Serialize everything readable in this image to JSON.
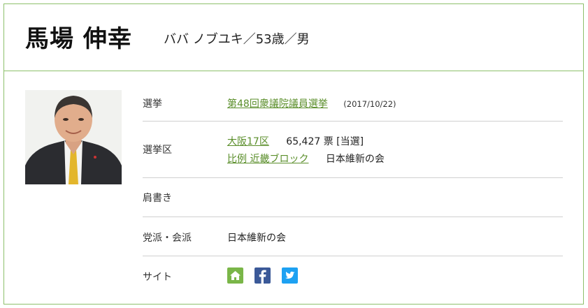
{
  "candidate": {
    "name": "馬場 伸幸",
    "kana_info": "ババ ノブユキ／53歳／男"
  },
  "rows": {
    "election": {
      "label": "選挙",
      "link": "第48回衆議院議員選挙",
      "date": "(2017/10/22)"
    },
    "district": {
      "label": "選挙区",
      "district_link": "大阪17区",
      "votes": "65,427 票 [当選]",
      "pr_link": "比例 近畿ブロック",
      "pr_party": "日本維新の会"
    },
    "title": {
      "label": "肩書き"
    },
    "party": {
      "label": "党派・会派",
      "value": "日本維新の会"
    },
    "site": {
      "label": "サイト",
      "icons": [
        "home-icon",
        "facebook-icon",
        "twitter-icon"
      ]
    }
  },
  "colors": {
    "border": "#8dc06b",
    "link": "#5a8e2a",
    "home": "#7ab648",
    "facebook": "#3b5998",
    "twitter": "#1da1f2"
  }
}
